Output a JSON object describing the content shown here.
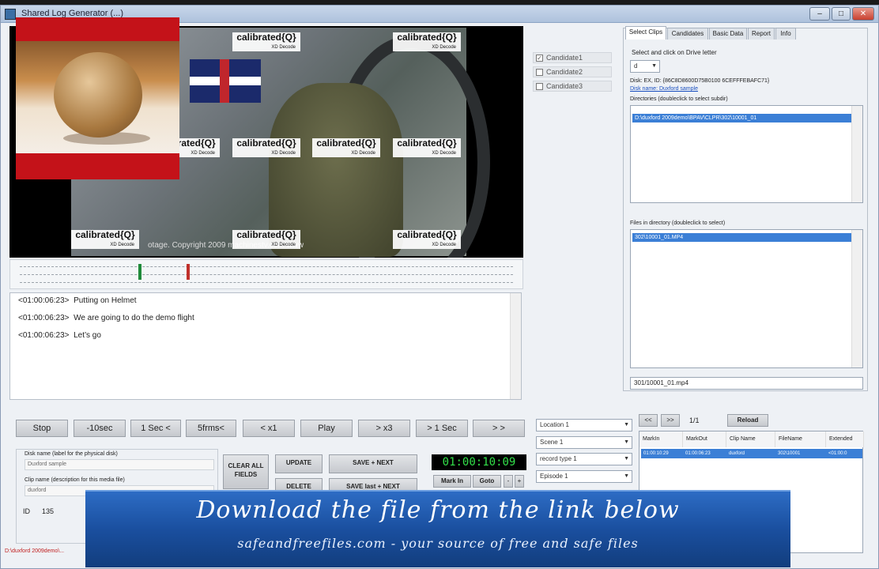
{
  "window": {
    "title": "Shared Log Generator (...)",
    "minimize_label": "–",
    "maximize_label": "□",
    "close_label": "✕"
  },
  "video": {
    "watermark_text": "calibrated{Q}",
    "watermark_sub": "XD Decode",
    "copyright_text": "otage. Copyright 2009 machinestv.com     www"
  },
  "transcript": {
    "lines": [
      {
        "tc": "<01:00:06:23>",
        "text": "Putting on Helmet"
      },
      {
        "tc": "<01:00:06:23>",
        "text": "We are going to do the demo flight"
      },
      {
        "tc": "<01:00:06:23>",
        "text": "Let’s go"
      }
    ]
  },
  "transport": {
    "stop": "Stop",
    "minus10": "-10sec",
    "minus1": "1 Sec <",
    "frames_back": "5frms<",
    "rev_x1": "< x1",
    "play": "Play",
    "fwd_x3": "> x3",
    "plus1": "> 1 Sec",
    "end": "> >"
  },
  "candidates": [
    {
      "label": "Candidate1",
      "checked": true
    },
    {
      "label": "Candidate2",
      "checked": false
    },
    {
      "label": "Candidate3",
      "checked": false
    }
  ],
  "right_panel": {
    "tabs": [
      "Select Clips",
      "Candidates",
      "Basic Data",
      "Report",
      "Info"
    ],
    "drive_prompt": "Select and click on Drive letter",
    "drive_value": "d",
    "disk_id": "Disk: EX, ID: {86C8D8600D75B0100 6CEFFFEBAFC71}",
    "disk_link": "Disk name: Duxford sample",
    "dirs_label": "Directories (doubleclick to select subdir)",
    "dir_selected": "D:\\duxford 2009demo\\BPAV\\CLPR\\302\\10001_01",
    "files_label": "Files in directory (doubleclick to select)",
    "file_selected": "302\\10001_01.MP4",
    "current_file": "301/10001_01.mp4"
  },
  "meta_combos": [
    "Location 1",
    "Scene 1",
    "record type 1",
    "Episode 1"
  ],
  "nav": {
    "prev": "<<",
    "next": ">>",
    "page": "1/1",
    "reload": "Reload"
  },
  "grid": {
    "headers": [
      "MarkIn",
      "MarkOut",
      "Clip Name",
      "FileName",
      "Extended"
    ],
    "row": [
      "01:00:10:29",
      "01:00:06:23",
      "duxford",
      "302\\10001",
      "<01:00:0"
    ]
  },
  "timecode": "01:00:10:09",
  "mark_controls": {
    "mark_in": "Mark In",
    "goto": "Goto"
  },
  "form": {
    "disk_label": "Disk name (label for the physical disk)",
    "disk_value": "Duxford sample",
    "clip_label": "Clip name (description for this media file)",
    "clip_value": "duxford",
    "id_label": "ID",
    "id_value": "135"
  },
  "actions": {
    "clear": "CLEAR ALL FIELDS",
    "update": "UPDATE",
    "save_next": "SAVE + NEXT",
    "delete": "DELETE",
    "save_last_next": "SAVE last + NEXT"
  },
  "banner": {
    "title": "Download the file from the link below",
    "subtitle": "safeandfreefiles.com - your source of free and safe files"
  },
  "status_text": "D:\\duxford 2009demo\\..."
}
